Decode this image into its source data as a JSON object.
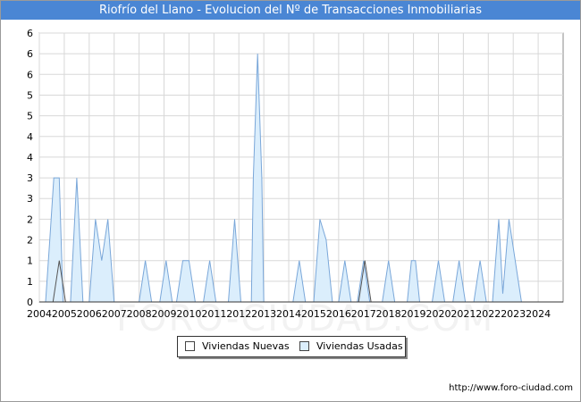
{
  "header": {
    "title": "Riofrío del Llano - Evolucion del Nº de Transacciones Inmobiliarias"
  },
  "legend": {
    "new_label": "Viviendas Nuevas",
    "used_label": "Viviendas Usadas"
  },
  "footer": {
    "url": "http://www.foro-ciudad.com"
  },
  "watermark": {
    "text": "FORO-CIUDAD.COM"
  },
  "colors": {
    "title_bg": "#4a86d4",
    "used_fill": "#dbeefc",
    "used_line": "#7aa7d9",
    "new_fill": "#ffffff",
    "new_line": "#555555",
    "grid": "#d8d8d8"
  },
  "chart_data": {
    "type": "area",
    "title": "Riofrío del Llano - Evolucion del Nº de Transacciones Inmobiliarias",
    "xlabel": "",
    "ylabel": "",
    "x_tick_labels": [
      "2004",
      "2005",
      "2006",
      "2007",
      "2008",
      "2009",
      "2010",
      "2011",
      "2012",
      "2013",
      "2014",
      "2015",
      "2016",
      "2017",
      "2018",
      "2019",
      "2020",
      "2021",
      "2022",
      "2023",
      "2024"
    ],
    "y_tick_labels": [
      "0",
      "1",
      "1",
      "2",
      "2",
      "3",
      "3",
      "4",
      "4",
      "5",
      "5",
      "6",
      "6",
      "6"
    ],
    "xlim": [
      2004,
      2025
    ],
    "ylim": [
      0,
      6.5
    ],
    "grid": true,
    "legend_position": "bottom",
    "series": [
      {
        "name": "Viviendas Usadas",
        "points": [
          [
            2004.0,
            0
          ],
          [
            2004.25,
            0
          ],
          [
            2004.42,
            1.5
          ],
          [
            2004.58,
            3
          ],
          [
            2004.8,
            3
          ],
          [
            2004.95,
            0
          ],
          [
            2005.25,
            0
          ],
          [
            2005.5,
            3
          ],
          [
            2005.75,
            0
          ],
          [
            2006.0,
            0
          ],
          [
            2006.25,
            2
          ],
          [
            2006.5,
            1
          ],
          [
            2006.75,
            2
          ],
          [
            2007.0,
            0
          ],
          [
            2008.0,
            0
          ],
          [
            2008.25,
            1
          ],
          [
            2008.5,
            0
          ],
          [
            2008.83,
            0
          ],
          [
            2009.08,
            1
          ],
          [
            2009.33,
            0
          ],
          [
            2009.5,
            0
          ],
          [
            2009.75,
            1
          ],
          [
            2010.0,
            1
          ],
          [
            2010.25,
            0
          ],
          [
            2010.58,
            0
          ],
          [
            2010.83,
            1
          ],
          [
            2011.08,
            0
          ],
          [
            2011.58,
            0
          ],
          [
            2011.83,
            2
          ],
          [
            2012.08,
            0
          ],
          [
            2012.5,
            0
          ],
          [
            2012.58,
            3
          ],
          [
            2012.75,
            6
          ],
          [
            2012.92,
            3
          ],
          [
            2013.0,
            0
          ],
          [
            2014.17,
            0
          ],
          [
            2014.42,
            1
          ],
          [
            2014.67,
            0
          ],
          [
            2015.0,
            0
          ],
          [
            2015.25,
            2
          ],
          [
            2015.5,
            1.5
          ],
          [
            2015.75,
            0
          ],
          [
            2016.0,
            0
          ],
          [
            2016.25,
            1
          ],
          [
            2016.5,
            0
          ],
          [
            2016.75,
            0
          ],
          [
            2017.0,
            1
          ],
          [
            2017.25,
            0
          ],
          [
            2017.75,
            0
          ],
          [
            2018.0,
            1
          ],
          [
            2018.25,
            0
          ],
          [
            2018.75,
            0
          ],
          [
            2018.92,
            1
          ],
          [
            2019.08,
            1
          ],
          [
            2019.25,
            0
          ],
          [
            2019.75,
            0
          ],
          [
            2020.0,
            1
          ],
          [
            2020.25,
            0
          ],
          [
            2020.58,
            0
          ],
          [
            2020.83,
            1
          ],
          [
            2021.08,
            0
          ],
          [
            2021.42,
            0
          ],
          [
            2021.67,
            1
          ],
          [
            2021.92,
            0
          ],
          [
            2022.17,
            0
          ],
          [
            2022.42,
            2
          ],
          [
            2022.58,
            0.2
          ],
          [
            2022.83,
            2
          ],
          [
            2023.08,
            1
          ],
          [
            2023.33,
            0
          ],
          [
            2025.0,
            0
          ]
        ]
      },
      {
        "name": "Viviendas Nuevas",
        "points": [
          [
            2004.0,
            0
          ],
          [
            2004.55,
            0
          ],
          [
            2004.8,
            1
          ],
          [
            2005.05,
            0
          ],
          [
            2016.8,
            0
          ],
          [
            2017.05,
            1
          ],
          [
            2017.3,
            0
          ],
          [
            2025.0,
            0
          ]
        ]
      }
    ]
  }
}
